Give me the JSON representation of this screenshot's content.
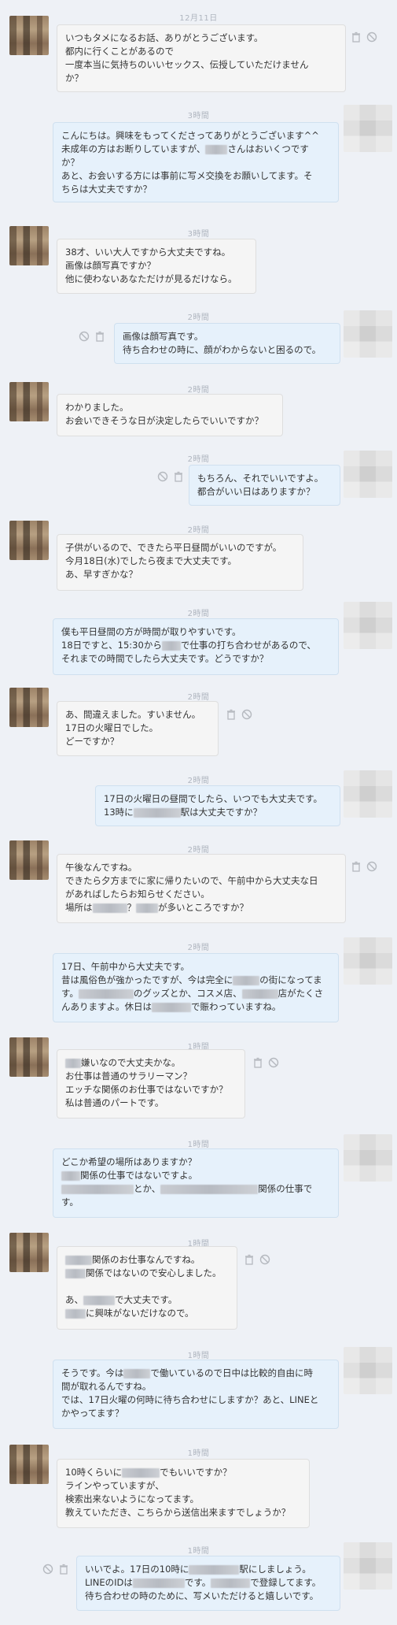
{
  "messages": [
    {
      "time": "12月11日",
      "lines": [
        "いつもタメになるお話、ありがとうございます。",
        "都内に行くことがあるので",
        "一度本当に気持ちのいいセックス、伝授していただけません",
        "か？"
      ]
    },
    {
      "time": "3時間",
      "lines": [
        "こんにちは。興味をもってくださってありがとうございます^^",
        "未成年の方はお断りしていますが、",
        "さんはおいくつです",
        "か？",
        "あと、お会いする方には事前に写メ交換をお願いしてます。そ",
        "ちらは大丈夫ですか？"
      ]
    },
    {
      "time": "3時間",
      "lines": [
        "38才、いい大人ですから大丈夫ですね。",
        "画像は顔写真ですか？",
        "他に使わないあなただけが見るだけなら。"
      ]
    },
    {
      "time": "2時間",
      "lines": [
        "画像は顔写真です。",
        "待ち合わせの時に、顔がわからないと困るので。"
      ]
    },
    {
      "time": "2時間",
      "lines": [
        "わかりました。",
        "お会いできそうな日が決定したらでいいですか？"
      ]
    },
    {
      "time": "2時間",
      "lines": [
        "もちろん、それでいいですよ。",
        "都合がいい日はありますか？"
      ]
    },
    {
      "time": "2時間",
      "lines": [
        "子供がいるので、できたら平日昼間がいいのですが。",
        "今月18日(水)でしたら夜まで大丈夫です。",
        "あ、早すぎかな？"
      ]
    },
    {
      "time": "2時間",
      "lines": [
        "僕も平日昼間の方が時間が取りやすいです。",
        "18日ですと、15:30から",
        "で仕事の打ち合わせがあるので、",
        "それまでの時間でしたら大丈夫です。どうですか？"
      ]
    },
    {
      "time": "2時間",
      "lines": [
        "あ、間違えました。すいません。",
        "17日の火曜日でした。",
        "どーですか？"
      ]
    },
    {
      "time": "2時間",
      "lines": [
        "17日の火曜日の昼間でしたら、いつでも大丈夫です。",
        "13時に",
        "駅は大丈夫ですか？"
      ]
    },
    {
      "time": "2時間",
      "lines": [
        "午後なんですね。",
        "できたら夕方までに家に帰りたいので、午前中から大丈夫な日",
        "があればしたらお知らせください。",
        "場所は",
        "？",
        "が多いところですか？"
      ]
    },
    {
      "time": "2時間",
      "lines": [
        "17日、午前中から大丈夫です。",
        "昔は風俗色が強かったですが、今は完全に",
        "の街になってま",
        "す。",
        "のグッズとか、コスメ店、",
        "店がたくさ",
        "んありますよ。休日は",
        "で賑わっていますね。"
      ]
    },
    {
      "time": "1時間",
      "lines": [
        "嫌いなので大丈夫かな。",
        "お仕事は普通のサラリーマン？",
        "エッチな関係のお仕事ではないですか？",
        "私は普通のパートです。"
      ]
    },
    {
      "time": "1時間",
      "lines": [
        "どこか希望の場所はありますか？",
        "関係の仕事ではないですよ。",
        "とか、",
        "関係の仕事で",
        "す。"
      ]
    },
    {
      "time": "1時間",
      "lines": [
        "関係のお仕事なんですね。",
        "関係ではないので安心しました。",
        "あ、",
        "で大丈夫です。",
        "に興味がないだけなので。"
      ]
    },
    {
      "time": "1時間",
      "lines": [
        "そうです。今は",
        "で働いているので日中は比較的自由に時",
        "間が取れるんですね。",
        "では、17日火曜の何時に待ち合わせにしますか？あと、LINEと",
        "かやってます？"
      ]
    },
    {
      "time": "1時間",
      "lines": [
        "10時くらいに",
        "でもいいですか？",
        "ラインやっていますが、",
        "検索出来ないようになってます。",
        "教えていただき、こちらから送信出来ますでしょうか？"
      ]
    },
    {
      "time": "1時間",
      "lines": [
        "いいでよ。17日の10時に",
        "駅にしましょう。",
        "LINEのIDは",
        "です。",
        "で登録してます。",
        "待ち合わせの時のために、写メいただけると嬉しいです。"
      ]
    }
  ],
  "icons": {
    "delete": "trash-icon",
    "block": "block-icon"
  },
  "colors": {
    "incoming_bg": "#f5f5f5",
    "outgoing_bg": "#e6f1fb",
    "page_bg": "#eef1f6"
  }
}
